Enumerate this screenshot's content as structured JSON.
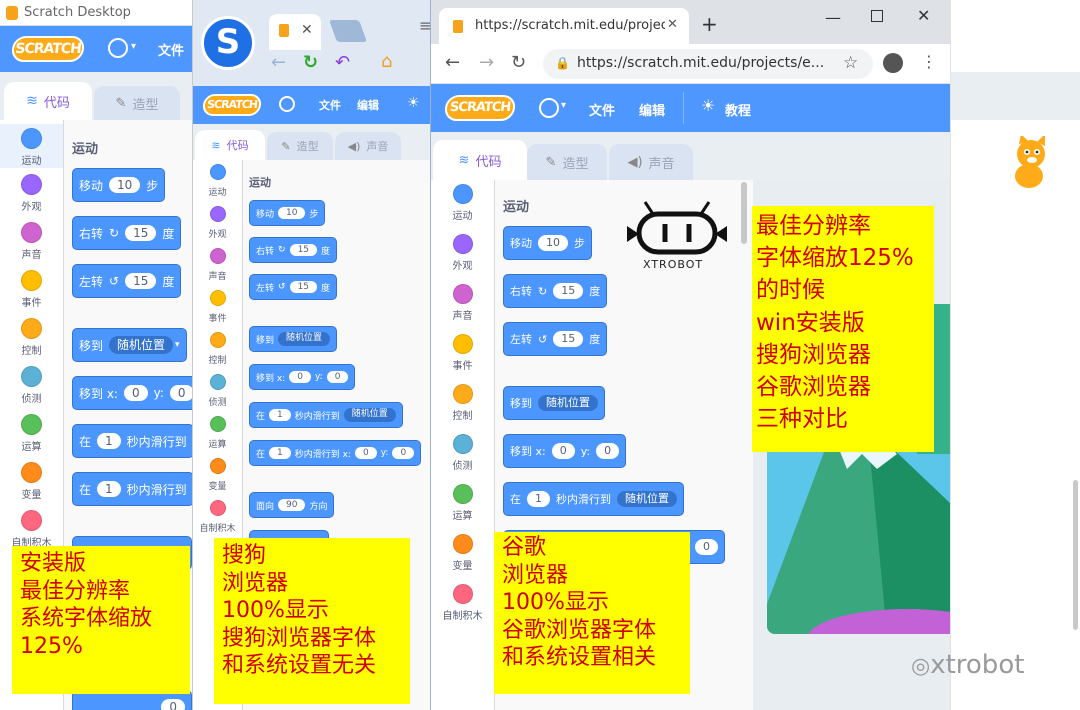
{
  "window1": {
    "title": "Scratch Desktop",
    "logo": "SCRATCH",
    "menu_file": "文件",
    "tab_code": "代码",
    "tab_costume": "造型",
    "section_motion": "运动",
    "categories": [
      "运动",
      "外观",
      "声音",
      "事件",
      "控制",
      "侦测",
      "运算",
      "变量",
      "自制积木"
    ],
    "blocks": {
      "move": "移动",
      "move_val": "10",
      "steps": "步",
      "turn_right": "右转",
      "turn_left": "左转",
      "turn_val": "15",
      "degrees": "度",
      "goto": "移到",
      "goto_opt": "随机位置",
      "goto_xy": "移到 x:",
      "x_val": "0",
      "y_label": "y:",
      "y_val": "0",
      "glide_in": "在",
      "glide_val": "1",
      "glide_text": "秒内滑行到",
      "partial_val": "0"
    },
    "note": "安装版\n最佳分辨率\n系统字体缩放\n125%"
  },
  "window2": {
    "logo": "SCRATCH",
    "menu_file": "文件",
    "menu_edit": "编辑",
    "tab_code": "代码",
    "tab_costume": "造型",
    "tab_sound": "声音",
    "section_motion": "运动",
    "categories": [
      "运动",
      "外观",
      "声音",
      "事件",
      "控制",
      "侦测",
      "运算",
      "变量",
      "自制积木"
    ],
    "blocks": {
      "move": "移动",
      "move_val": "10",
      "steps": "步",
      "turn_right": "右转",
      "turn_left": "左转",
      "turn_val": "15",
      "degrees": "度",
      "goto": "移到",
      "goto_opt": "随机位置",
      "goto_xy": "移到 x:",
      "x_val": "0",
      "y_label": "y:",
      "y_val": "0",
      "glide_in": "在",
      "glide_val": "1",
      "glide_text": "秒内滑行到",
      "glide_text2": "秒内滑行到 x:",
      "point": "面向",
      "point_val": "90",
      "direction": "方向"
    },
    "note": "搜狗\n浏览器\n100%显示\n搜狗浏览器字体\n和系统设置无关"
  },
  "window3": {
    "tab_title": "https://scratch.mit.edu/projec",
    "url": "https://scratch.mit.edu/projects/e...",
    "logo": "SCRATCH",
    "menu_file": "文件",
    "menu_edit": "编辑",
    "menu_tutorials": "教程",
    "tab_code": "代码",
    "tab_costume": "造型",
    "tab_sound": "声音",
    "section_motion": "运动",
    "categories": [
      "运动",
      "外观",
      "声音",
      "事件",
      "控制",
      "侦测",
      "运算",
      "变量",
      "自制积木"
    ],
    "blocks": {
      "move": "移动",
      "move_val": "10",
      "steps": "步",
      "turn_right": "右转",
      "turn_left": "左转",
      "turn_val": "15",
      "degrees": "度",
      "goto": "移到",
      "goto_opt": "随机位置",
      "goto_xy": "移到 x:",
      "x_val": "0",
      "y_label": "y:",
      "y_val": "0",
      "glide_in": "在",
      "glide_val": "1",
      "glide_text": "秒内滑行到",
      "partial_val": "0"
    },
    "brand": "XTROBOT",
    "note_left": "谷歌\n浏览器\n100%显示\n谷歌浏览器字体\n和系统设置相关",
    "note_right": "最佳分辨率\n字体缩放125%\n的时候\nwin安装版\n搜狗浏览器\n谷歌浏览器\n三种对比"
  },
  "watermark": "xtrobot",
  "colors": {
    "scratch_blue": "#4d97ff",
    "motion": "#4c97ff",
    "note_bg": "#ffff00",
    "note_text": "#d10000"
  },
  "category_colors": [
    "#4c97ff",
    "#9966ff",
    "#cf63cf",
    "#ffbf00",
    "#ffab19",
    "#5cb1d6",
    "#59c059",
    "#ff8c1a",
    "#ff6680"
  ]
}
